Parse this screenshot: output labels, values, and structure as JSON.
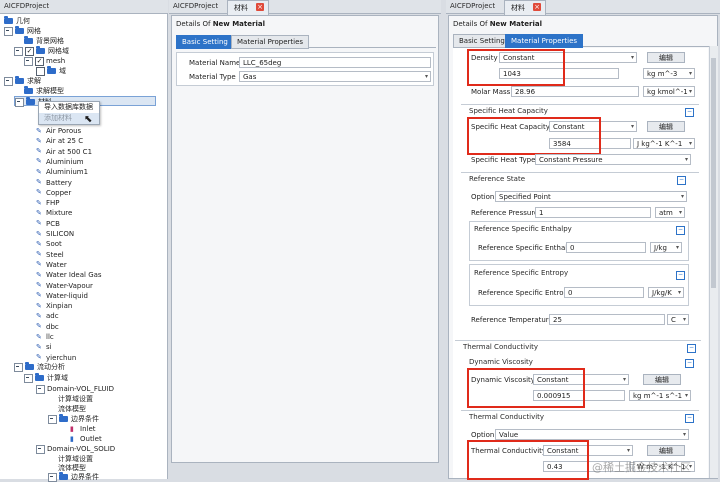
{
  "left": {
    "title": "AICFDProject",
    "tree": [
      {
        "label": "几何"
      },
      {
        "label": "网格"
      },
      {
        "label": "背景网格"
      },
      {
        "label": "网格域"
      },
      {
        "label": "mesh"
      },
      {
        "label": "域"
      },
      {
        "label": "求解"
      },
      {
        "label": "求解模型"
      },
      {
        "label": "材料"
      },
      {
        "label": "Air Porous"
      },
      {
        "label": "Air at 25 C"
      },
      {
        "label": "Air at 500 C1"
      },
      {
        "label": "Aluminium"
      },
      {
        "label": "Aluminium1"
      },
      {
        "label": "Battery"
      },
      {
        "label": "Copper"
      },
      {
        "label": "FHP"
      },
      {
        "label": "Mixture"
      },
      {
        "label": "PCB"
      },
      {
        "label": "SILICON"
      },
      {
        "label": "Soot"
      },
      {
        "label": "Steel"
      },
      {
        "label": "Water"
      },
      {
        "label": "Water Ideal Gas"
      },
      {
        "label": "Water-Vapour"
      },
      {
        "label": "Water-liquid"
      },
      {
        "label": "Xinpian"
      },
      {
        "label": "adc"
      },
      {
        "label": "dbc"
      },
      {
        "label": "llc"
      },
      {
        "label": "si"
      },
      {
        "label": "yierchun"
      },
      {
        "label": "流动分析"
      },
      {
        "label": "计算域"
      },
      {
        "label": "Domain-VOL_FLUID"
      },
      {
        "label": "计算域设置"
      },
      {
        "label": "流体模型"
      },
      {
        "label": "边界条件"
      },
      {
        "label": "Inlet"
      },
      {
        "label": "Outlet"
      },
      {
        "label": "Domain-VOL_SOLID"
      },
      {
        "label": "计算域设置"
      },
      {
        "label": "流体模型"
      },
      {
        "label": "边界条件"
      }
    ],
    "context_menu": [
      "导入数据库数据",
      "添加材料"
    ]
  },
  "middle": {
    "title": "AICFDProject",
    "doc_tab": "材料",
    "details_prefix": "Details Of",
    "details_name": "New Material",
    "tabs": [
      "Basic Setting",
      "Material Properties"
    ],
    "material_name_label": "Material Name",
    "material_name_value": "LLC_65deg",
    "material_type_label": "Material Type",
    "material_type_value": "Gas"
  },
  "right": {
    "title": "AICFDProject",
    "doc_tab": "材料",
    "details_prefix": "Details Of",
    "details_name": "New Material",
    "tabs": [
      "Basic Setting",
      "Material Properties"
    ],
    "edit_label": "编辑",
    "density": {
      "label": "Density",
      "mode": "Constant",
      "value": "1043",
      "unit": "kg m^-3"
    },
    "molar_mass": {
      "label": "Molar Mass",
      "value": "28.96",
      "unit": "kg kmol^-1"
    },
    "specific_heat": {
      "group": "Specific Heat Capacity",
      "label": "Specific Heat Capacity",
      "mode": "Constant",
      "value": "3584",
      "unit": "J kg^-1 K^-1",
      "type_label": "Specific Heat Type",
      "type_value": "Constant Pressure"
    },
    "reference_state": {
      "group": "Reference State",
      "option_label": "Option",
      "option_value": "Specified Point",
      "pressure_label": "Reference Pressure",
      "pressure_value": "1",
      "pressure_unit": "atm",
      "enthalpy_group": "Reference Specific Enthalpy",
      "enthalpy_label": "Reference Specific Enthalpy",
      "enthalpy_value": "0",
      "enthalpy_unit": "J/kg",
      "entropy_group": "Reference Specific Entropy",
      "entropy_label": "Reference Specific Entropy",
      "entropy_value": "0",
      "entropy_unit": "J/kg/K",
      "temperature_label": "Reference Temperature",
      "temperature_value": "25",
      "temperature_unit": "C"
    },
    "thermal_group": "Thermal Conductivity",
    "viscosity": {
      "group": "Dynamic Viscosity",
      "label": "Dynamic Viscosity",
      "mode": "Constant",
      "value": "0.000915",
      "unit": "kg m^-1 s^-1"
    },
    "conductivity": {
      "group": "Thermal Conductivity",
      "option_label": "Option",
      "option_value": "Value",
      "label": "Thermal Conductivity",
      "mode": "Constant",
      "value": "0.43",
      "unit": "W m^-1 K^-1"
    },
    "watermark": "@稀土掘金技术社区"
  },
  "colors": {
    "accent": "#2d73c8",
    "highlight_box": "#e02a1a",
    "close": "#e04a3a"
  }
}
